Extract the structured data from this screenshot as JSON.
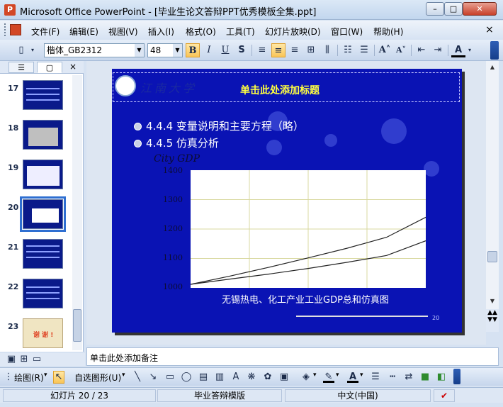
{
  "window": {
    "title": "Microsoft Office PowerPoint - [毕业生论文答辩PPT优秀模板全集.ppt]",
    "minimize": "–",
    "maximize": "□",
    "close": "✕"
  },
  "menu": {
    "items": [
      "文件(F)",
      "编辑(E)",
      "视图(V)",
      "插入(I)",
      "格式(O)",
      "工具(T)",
      "幻灯片放映(D)",
      "窗口(W)",
      "帮助(H)"
    ],
    "close": "×"
  },
  "format_toolbar": {
    "font_name": "楷体_GB2312",
    "font_size": "48",
    "bold": "B",
    "italic": "I",
    "underline": "U",
    "shadow": "S",
    "font_color": "A"
  },
  "left_pane": {
    "tab_outline": "☰",
    "tab_slides": "▢",
    "close": "×",
    "slides": [
      {
        "number": "17"
      },
      {
        "number": "18"
      },
      {
        "number": "19"
      },
      {
        "number": "20"
      },
      {
        "number": "21"
      },
      {
        "number": "22"
      },
      {
        "number": "23",
        "thumb_text": "谢 谢 !"
      }
    ],
    "selected_slide": "20"
  },
  "slide": {
    "logo_text": "江南大学",
    "title": "单击此处添加标题",
    "bullets": [
      "4.4.4 变量说明和主要方程（略）",
      "4.4.5 仿真分析"
    ],
    "page_number": "20"
  },
  "chart_data": {
    "type": "line",
    "title": "",
    "ylabel": "City GDP",
    "xlabel": "",
    "caption": "无锡热电、化工产业工业GDP总和仿真图",
    "ylim": [
      1000,
      1400
    ],
    "y_ticks": [
      "1400",
      "1300",
      "1200",
      "1100",
      "1000"
    ],
    "grid": true,
    "x": [
      0,
      1,
      2,
      3,
      4,
      5,
      6
    ],
    "series": [
      {
        "values": [
          1012,
          1040,
          1070,
          1102,
          1135,
          1172,
          1240
        ]
      },
      {
        "values": [
          1012,
          1030,
          1047,
          1066,
          1087,
          1110,
          1160
        ]
      }
    ],
    "colors": {
      "line": "#222222",
      "plot_bg": "#ffffff",
      "grid": "#d8d8a0"
    }
  },
  "notes": {
    "placeholder": "单击此处添加备注"
  },
  "drawing_toolbar": {
    "draw_menu": "绘图(R)",
    "autoshapes_menu": "自选图形(U)"
  },
  "status": {
    "slide_info": "幻灯片 20 / 23",
    "template": "毕业答辩模版",
    "language": "中文(中国)"
  },
  "colors": {
    "slide_bg": "#0a13b4",
    "title_text": "#ffff40",
    "chrome": "#d6e2f2"
  }
}
